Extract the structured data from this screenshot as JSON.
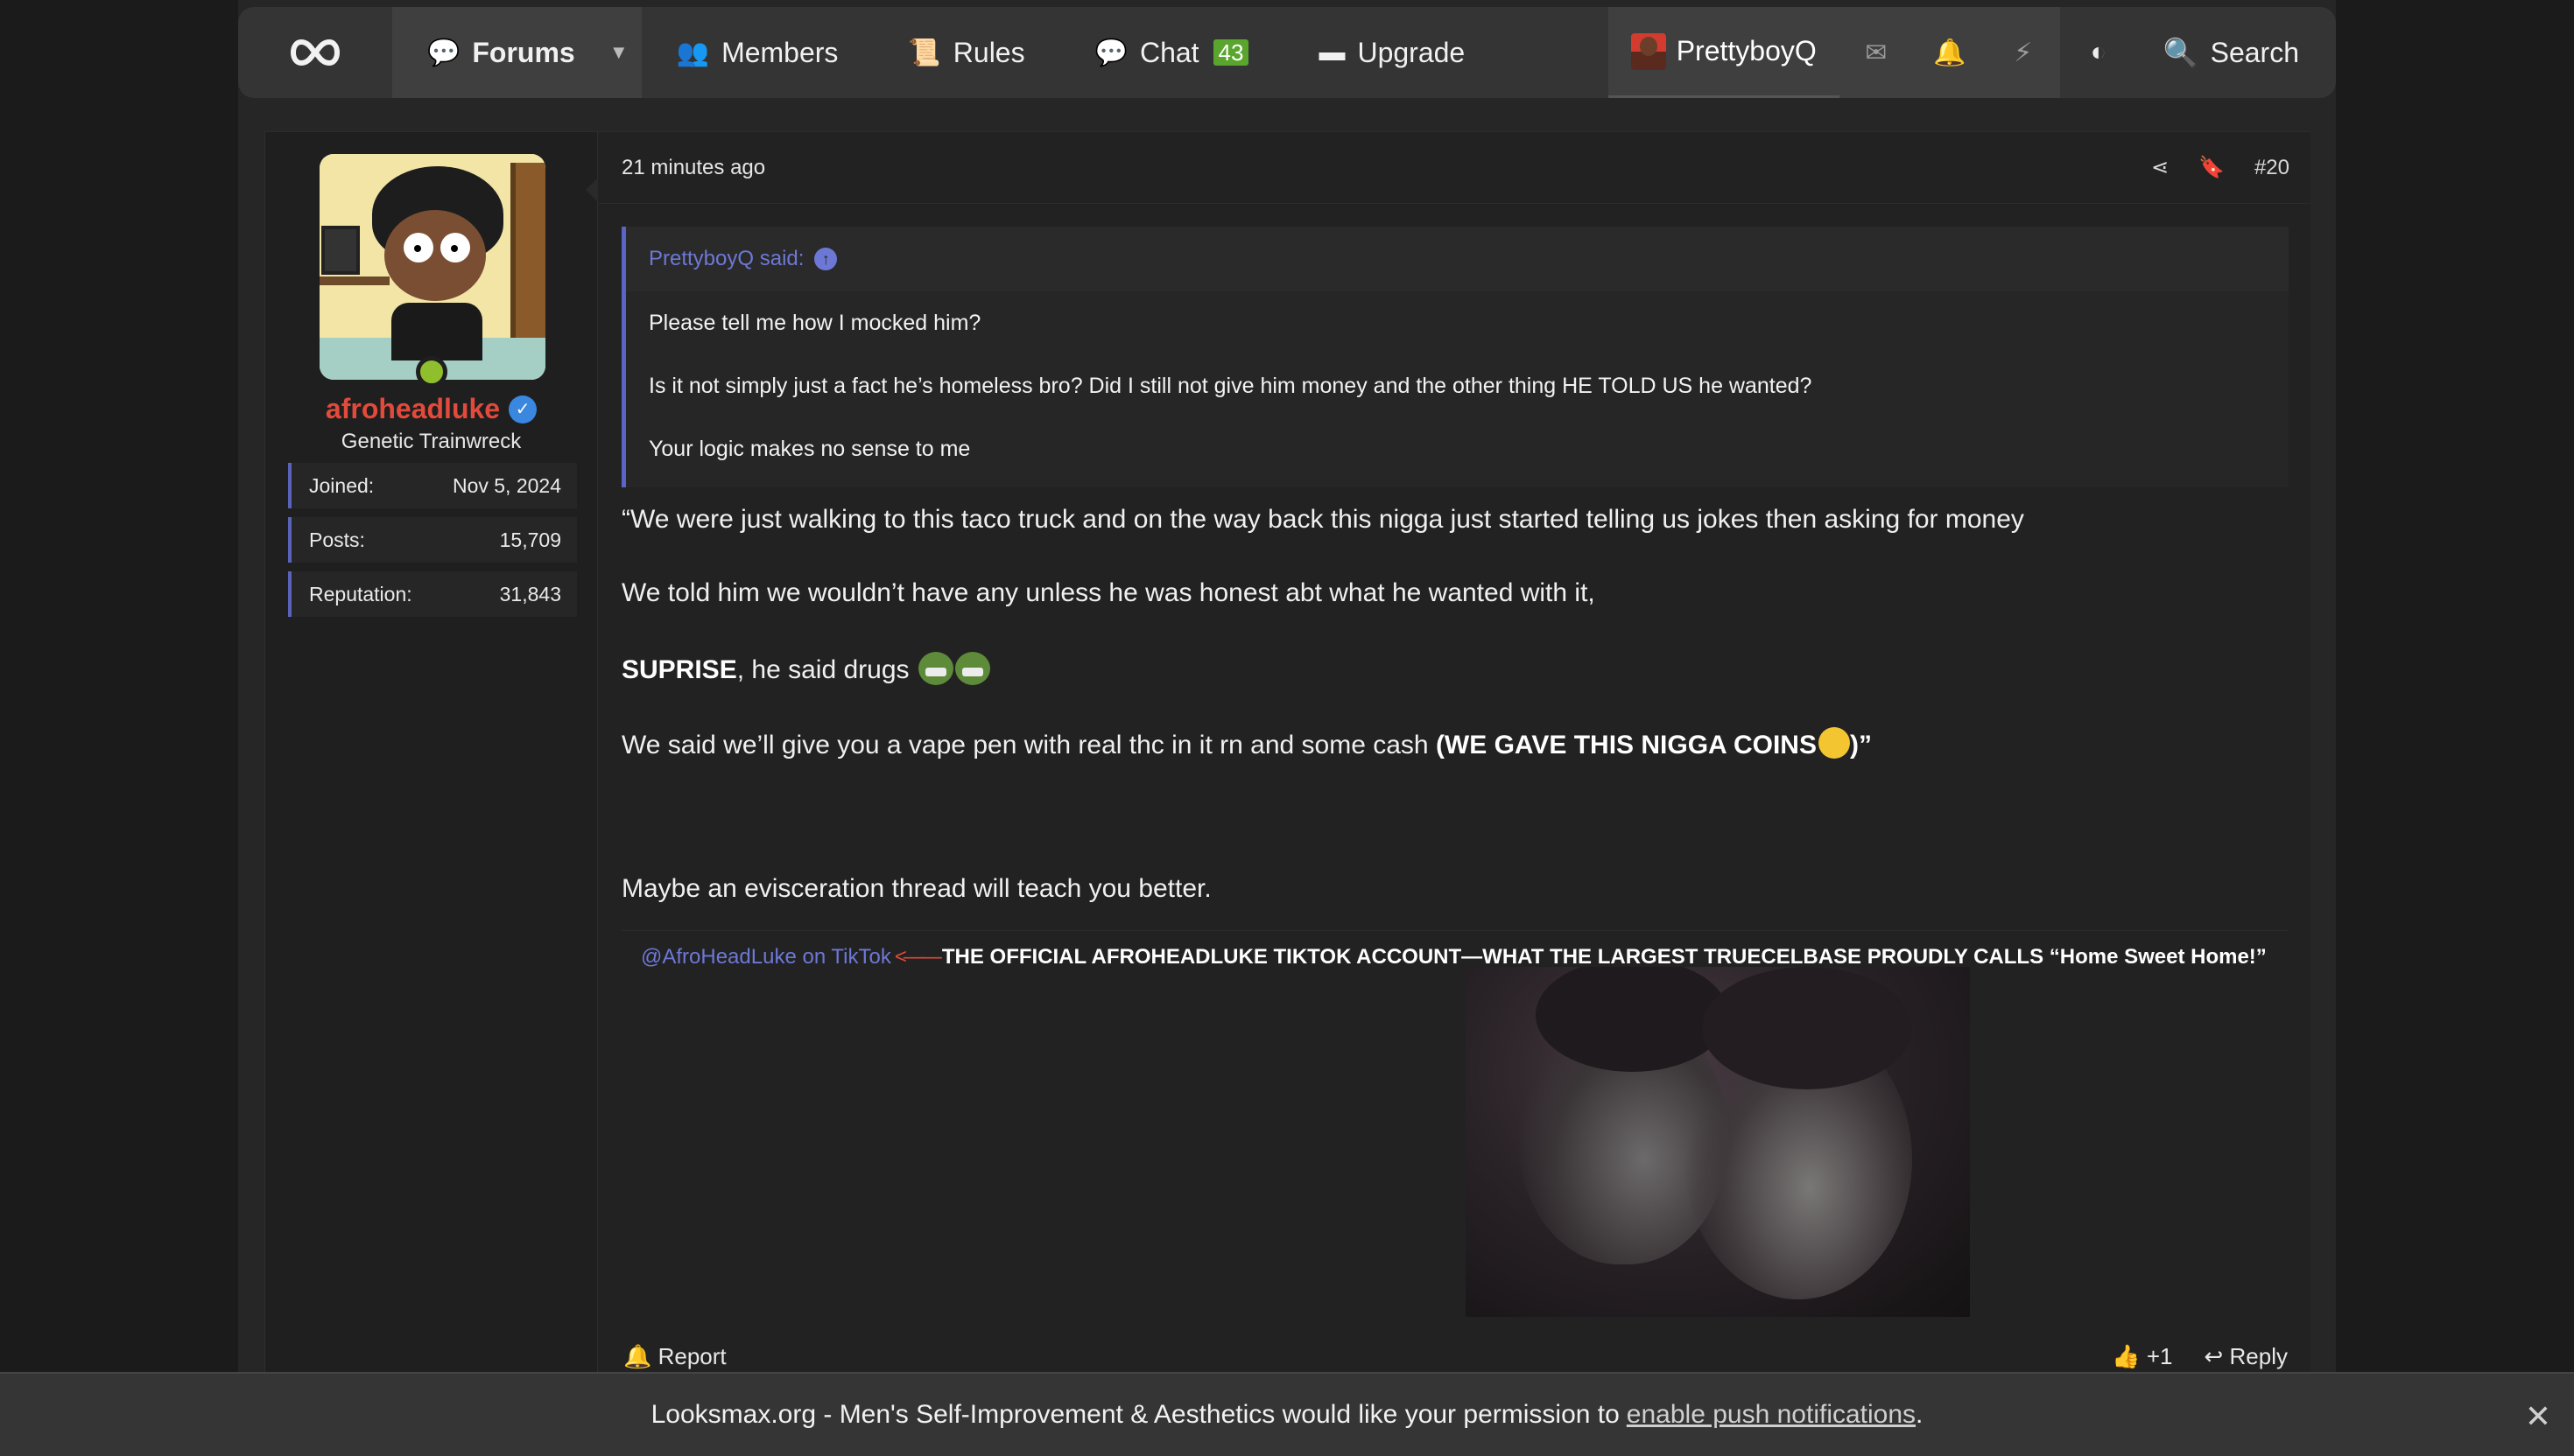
{
  "nav": {
    "forums": "Forums",
    "members": "Members",
    "rules": "Rules",
    "chat": "Chat",
    "chat_count": "43",
    "upgrade": "Upgrade",
    "username": "PrettyboyQ",
    "search": "Search"
  },
  "user": {
    "name": "afroheadluke",
    "title": "Genetic Trainwreck",
    "stats": [
      {
        "label": "Joined:",
        "value": "Nov 5, 2024"
      },
      {
        "label": "Posts:",
        "value": "15,709"
      },
      {
        "label": "Reputation:",
        "value": "31,843"
      }
    ]
  },
  "post": {
    "time": "21 minutes ago",
    "number": "#20",
    "quote": {
      "author": "PrettyboyQ said:",
      "lines": [
        "Please tell me how I mocked him?",
        "Is it not simply just a fact he’s homeless bro? Did I still not give him money and the other thing HE TOLD US he wanted?",
        "Your logic makes no sense to me"
      ]
    },
    "body": {
      "line1": "“We were just walking to this taco truck and on the way back this nigga just started telling us jokes then asking for money",
      "line2": "We told him we wouldn’t have any unless he was honest abt what he wanted with it,",
      "line3_bold": "SUPRISE",
      "line3_rest": ", he said drugs",
      "line4_start": "We said we’ll give you a vape pen with real thc in it rn and some cash ",
      "line4_bold": "(WE GAVE THIS NIGGA COINS",
      "line4_end": ")”",
      "line5": "Maybe an evisceration thread will teach you better."
    },
    "signature": {
      "link": "@AfroHeadLuke on TikTok",
      "arrow": "<——",
      "text": "THE OFFICIAL AFROHEADLUKE TIKTOK ACCOUNT—WHAT THE LARGEST TRUECELBASE PROUDLY CALLS “Home Sweet Home!”"
    },
    "footer": {
      "report": "Report",
      "like_count": "+1",
      "reply": "Reply"
    }
  },
  "push_banner": {
    "text": "Looksmax.org - Men's Self-Improvement & Aesthetics would like your permission to",
    "link": "enable push notifications",
    "end": "."
  },
  "colors": {
    "accent": "#5a64c8",
    "username": "#e24a3b",
    "chat_badge": "#5aa52d"
  }
}
